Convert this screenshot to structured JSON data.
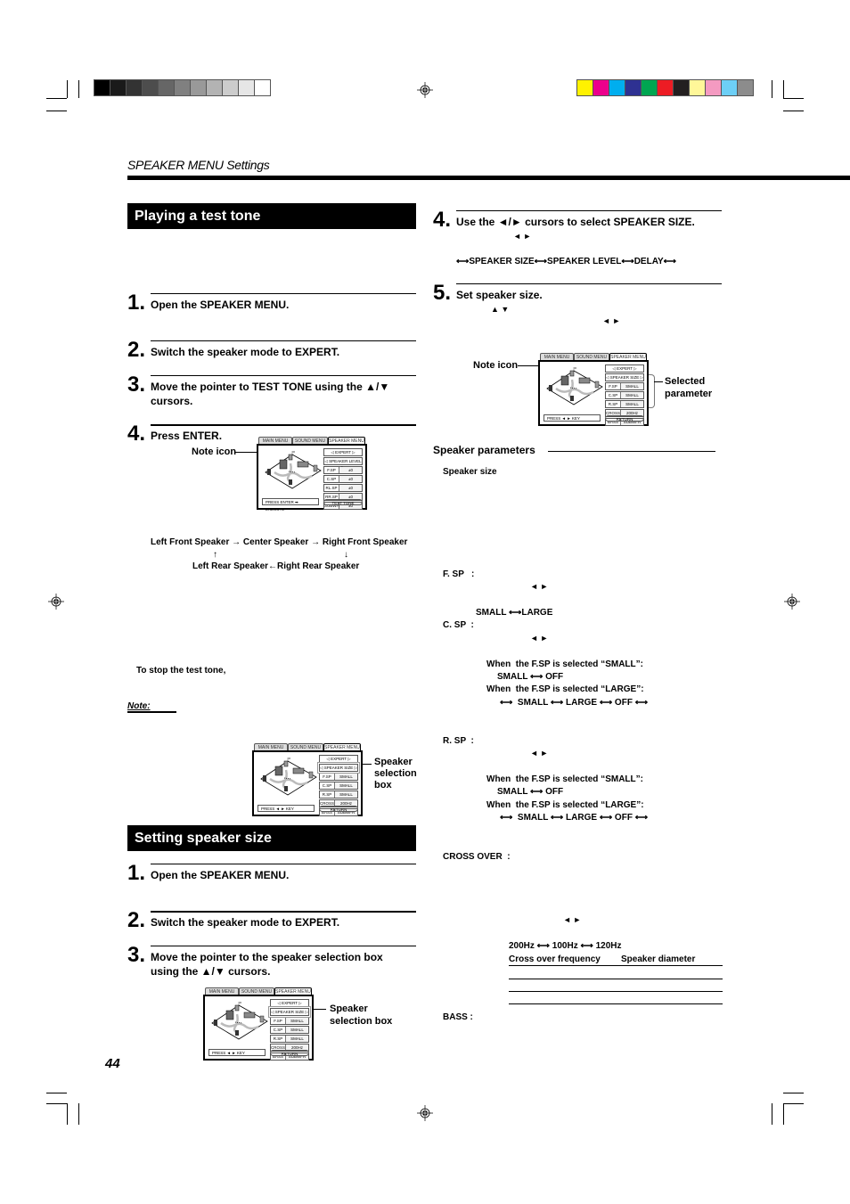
{
  "header": {
    "running_head": "SPEAKER MENU Settings",
    "page_number": "44"
  },
  "print_marks": {
    "gray_swatches": [
      "#000000",
      "#1a1a1a",
      "#333333",
      "#4d4d4d",
      "#666666",
      "#808080",
      "#999999",
      "#b3b3b3",
      "#cccccc",
      "#e6e6e6",
      "#ffffff"
    ],
    "color_swatches": [
      "#fff200",
      "#ec008c",
      "#00aeef",
      "#2e3192",
      "#00a651",
      "#ed1c24",
      "#231f20",
      "#fff799",
      "#f49ac1",
      "#6dcff6",
      "#8c8c8c"
    ]
  },
  "test_tone": {
    "title": "Playing a test tone",
    "steps": [
      {
        "num": "1.",
        "text": "Open the SPEAKER MENU."
      },
      {
        "num": "2.",
        "text": "Switch the speaker mode to EXPERT."
      },
      {
        "num": "3.",
        "text": "Move the pointer to TEST TONE using the ▲/▼ cursors."
      },
      {
        "num": "4.",
        "text": "Press ENTER."
      }
    ],
    "note_icon_label": "Note icon",
    "sequence": {
      "left_front": "Left Front Speaker",
      "center": "Center Speaker",
      "right_front": "Right Front Speaker",
      "left_rear": "Left Rear Speaker",
      "right_rear": "Right Rear Speaker",
      "arrow_right": "→",
      "arrow_left": "←",
      "arrow_up": "↑",
      "arrow_down": "↓"
    },
    "stop_label": "To stop the test tone,",
    "note_label": "Note:",
    "speaker_selection_label": "Speaker selection box"
  },
  "speaker_size": {
    "title": "Setting speaker size",
    "steps": [
      {
        "num": "1.",
        "text": "Open the SPEAKER MENU."
      },
      {
        "num": "2.",
        "text": "Switch the speaker mode to EXPERT."
      },
      {
        "num": "3.",
        "text": "Move the pointer to the speaker selection box using the ▲/▼ cursors."
      },
      {
        "num": "4.",
        "text": "Use the ◄/► cursors to select SPEAKER SIZE."
      },
      {
        "num": "5.",
        "text": "Set speaker size."
      }
    ],
    "lr_arrows": "◄ ►",
    "ud_arrows": "▲ ▼",
    "cycle": "⟷SPEAKER SIZE⟷SPEAKER LEVEL⟷DELAY⟷",
    "speaker_selection_label": "Speaker selection box",
    "note_icon_label": "Note icon",
    "selected_parameter_label": "Selected parameter"
  },
  "parameters": {
    "heading": "Speaker parameters",
    "subheading": "Speaker size",
    "fsp_label": "F. SP   :",
    "fsp_options": "SMALL ⟷LARGE",
    "csp_label": "C. SP  :",
    "rsp_label": "R. SP  :",
    "when_small": "When  the F.SP is selected “SMALL”:",
    "small_off": "SMALL ⟷ OFF",
    "when_large": "When  the F.SP is selected “LARGE”:",
    "small_large_off": "⟷  SMALL ⟷ LARGE ⟷ OFF ⟷",
    "crossover_label": "CROSS OVER  :",
    "crossover_options": "200Hz ⟷ 100Hz ⟷ 120Hz",
    "table_headers": [
      "Cross over frequency",
      "Speaker diameter"
    ],
    "bass_label": "BASS :"
  },
  "menus": {
    "tabs": [
      "MAIN MENU",
      "SOUND MENU",
      "SPEAKER MENU"
    ],
    "level_screen": {
      "rows": [
        {
          "label": "",
          "value": "EXPERT"
        },
        {
          "label": "",
          "value": "SPEAKER LEVEL"
        },
        {
          "label": "F.SP",
          "value": "±0"
        },
        {
          "label": "C.SP",
          "value": "±0"
        },
        {
          "label": "RL.SP",
          "value": "±0"
        },
        {
          "label": "RR.SP",
          "value": "±0"
        },
        {
          "label": "SUBWFR",
          "value": "±0"
        }
      ],
      "footer": "PRESS ENTER ➡ EXECUTE",
      "back": "TEST TONE"
    },
    "size_screen": {
      "rows": [
        {
          "label": "",
          "value": "EXPERT"
        },
        {
          "label": "",
          "value": "SPEAKER SIZE"
        },
        {
          "label": "F.SP",
          "value": "SMALL"
        },
        {
          "label": "C.SP",
          "value": "SMALL"
        },
        {
          "label": "R.SP",
          "value": "SMALL"
        },
        {
          "label": "CROSS",
          "value": "200Hz"
        },
        {
          "label": "BASS",
          "value": "SUBWFR"
        }
      ],
      "footer": "PRESS ◄ ► KEY",
      "back": "RETURN"
    }
  }
}
